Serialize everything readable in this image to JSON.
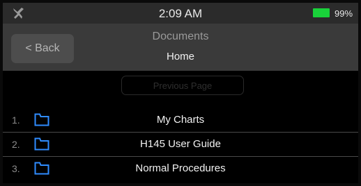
{
  "status_bar": {
    "left_icon": "airplane-icon",
    "time": "2:09 AM",
    "battery_color": "#19d23a",
    "battery_percent": "99%"
  },
  "header": {
    "back_label": "< Back",
    "title": "Documents",
    "subtitle": "Home"
  },
  "navigation": {
    "previous_page_label": "Previous Page"
  },
  "list": {
    "folder_icon": "folder-icon",
    "folder_color": "#2f8cff",
    "items": [
      {
        "number": "1.",
        "label": "My Charts"
      },
      {
        "number": "2.",
        "label": "H145 User Guide"
      },
      {
        "number": "3.",
        "label": "Normal Procedures"
      }
    ]
  }
}
